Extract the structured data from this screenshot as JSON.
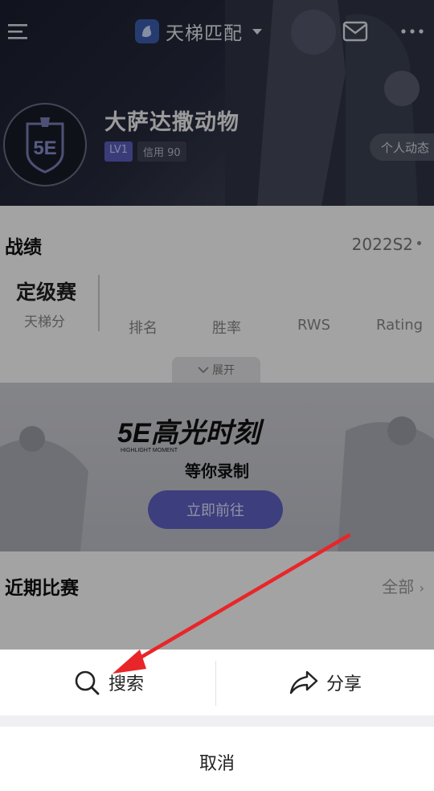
{
  "header": {
    "mode_label": "天梯匹配",
    "menu_icon": "menu-icon",
    "mail_icon": "mail-icon",
    "more_icon": "more-icon"
  },
  "profile": {
    "username": "大萨达撒动物",
    "level": "LV1",
    "credit": "信用 90",
    "activity_button": "个人动态",
    "avatar_text": "5E"
  },
  "stats": {
    "title": "战绩",
    "season": "2022S2",
    "rank_title": "定级赛",
    "rank_sub": "天梯分",
    "columns": [
      "排名",
      "胜率",
      "RWS",
      "Rating"
    ],
    "expand": "展开"
  },
  "banner": {
    "logo_text": "5E高光时刻",
    "logo_caption": "HIGHLIGHT MOMENT",
    "subtitle": "等你录制",
    "button": "立即前往"
  },
  "recent": {
    "title": "近期比赛",
    "all": "全部"
  },
  "sheet": {
    "search": "搜索",
    "share": "分享",
    "cancel": "取消"
  },
  "colors": {
    "accent": "#5f62c4",
    "annotation_arrow": "#e8262a",
    "overlay": "rgba(0,0,0,0.36)"
  }
}
